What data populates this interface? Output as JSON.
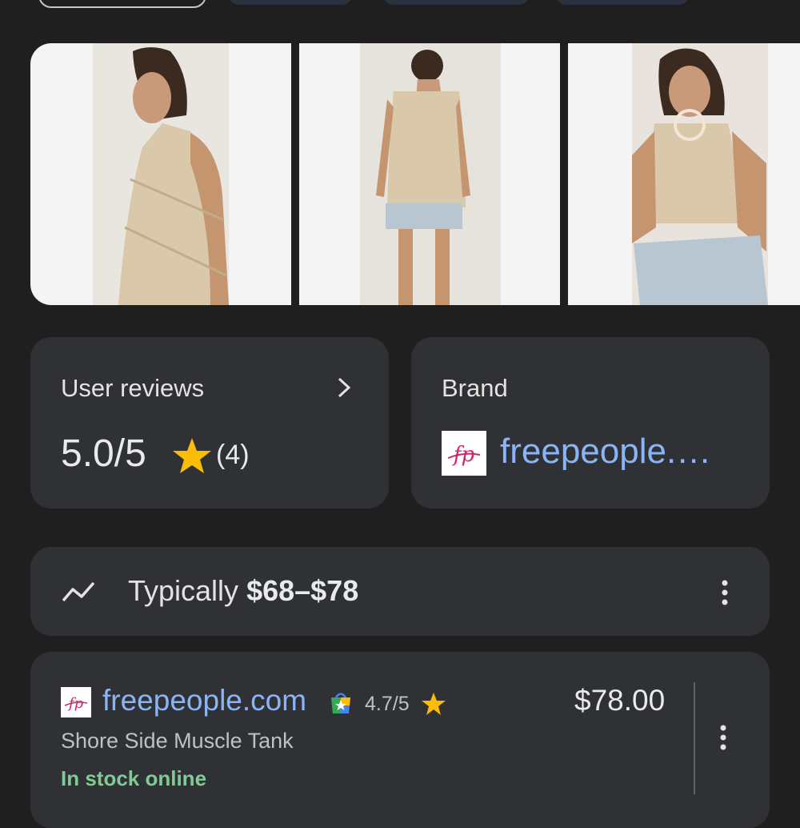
{
  "filter_chips": [
    {
      "active": true
    },
    {
      "active": false
    },
    {
      "active": false
    },
    {
      "active": false
    }
  ],
  "gallery": {
    "images": [
      {
        "icon": "model-side-view-photo"
      },
      {
        "icon": "model-back-view-photo"
      },
      {
        "icon": "model-seated-front-photo"
      }
    ]
  },
  "reviews_card": {
    "title": "User reviews",
    "score": "5.0/5",
    "count": "(4)",
    "chevron_icon": "chevron-right-icon",
    "star_color": "#fbbc04"
  },
  "brand_card": {
    "title": "Brand",
    "link": "freepeople.…",
    "logo_icon": "freepeople-logo"
  },
  "price_range": {
    "prefix": "Typically",
    "range": "$68–$78",
    "icon": "trend-line-icon"
  },
  "offer": {
    "merchant": "freepeople.com",
    "rating": "4.7/5",
    "price": "$78.00",
    "product_title": "Shore Side Muscle Tank",
    "availability": "In stock online",
    "bag_icon": "google-shopping-bag-icon",
    "availability_color": "#81c995"
  },
  "colors": {
    "background": "#1f1f1f",
    "card": "#303134",
    "link": "#8ab4f8"
  }
}
